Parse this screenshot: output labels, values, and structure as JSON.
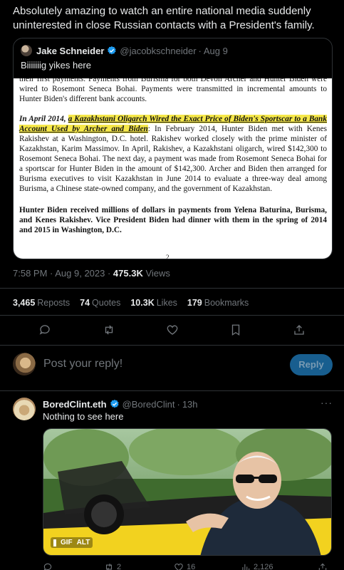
{
  "tweet": {
    "text": "Absolutely amazing to watch an entire national media suddenly uninterested in close Russian contacts with a President's family."
  },
  "quote": {
    "name": "Jake Schneider",
    "handle": "@jacobkschneider",
    "date": "Aug 9",
    "text": "Biiiiiiig yikes here",
    "document": {
      "p1": "their first payments. Payments from Burisma for both Devon Archer and Hunter Biden were wired to Rosemont Seneca Bohai. Payments were transmitted in incremental amounts to Hunter Biden's different bank accounts.",
      "p2_lead": "In April 2014,",
      "p2_highlight": "a Kazakhstani Oligarch Wired the Exact Price of Biden's Sportscar to a Bank Account Used by Archer and Biden",
      "p2_rest": ": In February 2014, Hunter Biden met with Kenes Rakishev at a Washington, D.C. hotel. Rakishev worked closely with the prime minister of Kazakhstan, Karim Massimov. In April, Rakishev, a Kazakhstani oligarch, wired $142,300 to Rosemont Seneca Bohai. The next day, a payment was made from Rosemont Seneca Bohai for a sportscar for Hunter Biden in the amount of $142,300. Archer and Biden then arranged for Burisma executives to visit Kazakhstan in June 2014 to evaluate a three-way deal among Burisma, a Chinese state-owned company, and the government of Kazakhstan.",
      "p3": "Hunter Biden received millions of dollars in payments from Yelena Baturina, Burisma, and Kenes Rakishev. Vice President Biden had dinner with them in the spring of 2014 and 2015 in Washington, D.C.",
      "page_number": "2"
    }
  },
  "meta": {
    "time": "7:58 PM · Aug 9, 2023 · ",
    "views": "475.3K",
    "views_label": " Views"
  },
  "stats": {
    "reposts": "3,465",
    "reposts_label": "Reposts",
    "quotes": "74",
    "quotes_label": "Quotes",
    "likes": "10.3K",
    "likes_label": "Likes",
    "bookmarks": "179",
    "bookmarks_label": "Bookmarks"
  },
  "reply_box": {
    "placeholder": "Post your reply!",
    "button": "Reply"
  },
  "reply": {
    "name": "BoredClint.eth",
    "handle": "@BoredClint",
    "time": "13h",
    "more": "···",
    "text": "Nothing to see here",
    "gif_label": "GIF",
    "alt_label": "ALT",
    "counts": {
      "replies": "",
      "reposts": "2",
      "likes": "16",
      "views": "2,126"
    }
  },
  "colors": {
    "accent": "#1d9bf0",
    "highlight": "#f6e84a",
    "car": "#f2d21f"
  }
}
